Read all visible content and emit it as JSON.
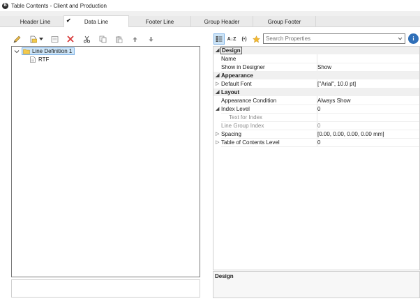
{
  "window": {
    "title": "Table Contents - Client and Production",
    "app_icon": "B"
  },
  "tabs": [
    {
      "label": "Header Line",
      "checked": false
    },
    {
      "label": "Data Line",
      "checked": true
    },
    {
      "label": "Footer Line",
      "checked": false
    },
    {
      "label": "Group Header",
      "checked": false
    },
    {
      "label": "Group Footer",
      "checked": false
    }
  ],
  "left_toolbar": [
    "pencil-icon",
    "new-item-icon",
    "dropdown-arrow-icon",
    "properties-icon",
    "delete-icon",
    "cut-icon",
    "copy-icon",
    "paste-icon",
    "move-up-icon",
    "move-down-icon"
  ],
  "tree": {
    "items": [
      {
        "label": "Line Definition  1",
        "selected": true,
        "icon": "folder-icon"
      },
      {
        "label": "RTF",
        "selected": false,
        "icon": "document-icon"
      }
    ]
  },
  "properties_toolbar": {
    "sort_label": "A↓Z",
    "expr_label": "(•)",
    "search_placeholder": "Search Properties",
    "info_label": "i"
  },
  "properties": [
    {
      "type": "category",
      "name": "Design"
    },
    {
      "type": "prop",
      "name": "Name",
      "value": ""
    },
    {
      "type": "prop",
      "name": "Show in Designer",
      "value": "Show"
    },
    {
      "type": "category",
      "name": "Appearance"
    },
    {
      "type": "prop",
      "name": "Default Font",
      "value": "[\"Arial\", 10.0 pt]",
      "expandable": true
    },
    {
      "type": "category",
      "name": "Layout"
    },
    {
      "type": "prop",
      "name": "Appearance Condition",
      "value": "Always Show"
    },
    {
      "type": "prop",
      "name": "Index Level",
      "value": "0",
      "expanded": true
    },
    {
      "type": "sub",
      "name": "Text for Index",
      "value": ""
    },
    {
      "type": "sub",
      "name": "Line Group Index",
      "value": "0"
    },
    {
      "type": "prop",
      "name": "Spacing",
      "value": "[0.00, 0.00, 0.00, 0.00 mm]",
      "expandable": true
    },
    {
      "type": "prop",
      "name": "Table of Contents Level",
      "value": "0",
      "expandable": true
    }
  ],
  "description": {
    "title": "Design"
  },
  "colors": {
    "accent": "#2f6fb8",
    "selection": "#cce4f7",
    "delete": "#d83b3b"
  }
}
